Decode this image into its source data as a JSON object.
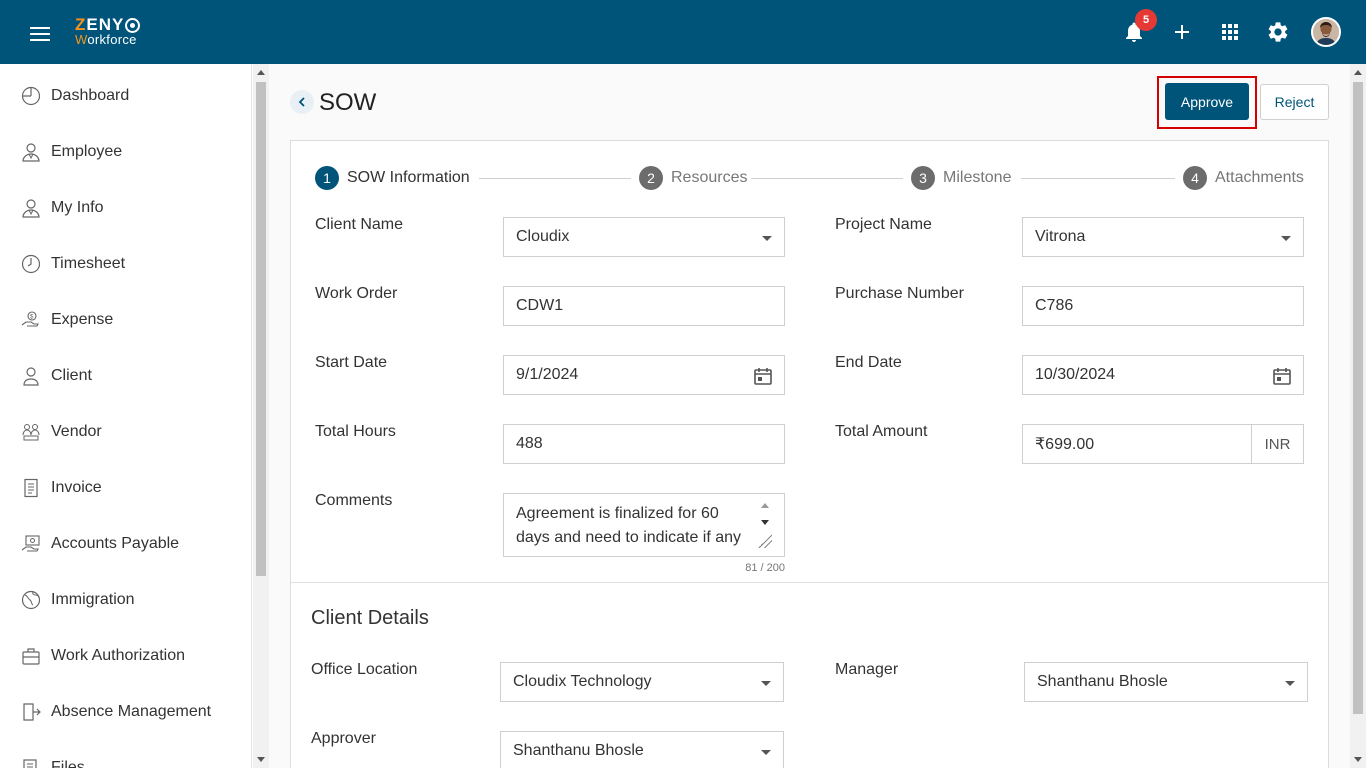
{
  "app": {
    "logo_line1_z": "Z",
    "logo_line1_rest": "ENY",
    "logo_line2_w": "W",
    "logo_line2_rest": "orkforce",
    "notification_count": "5",
    "brand_color": "#00547a",
    "accent_color": "#f7941d"
  },
  "sidebar": {
    "items": [
      {
        "label": "Dashboard",
        "icon": "dashboard-icon"
      },
      {
        "label": "Employee",
        "icon": "employee-icon"
      },
      {
        "label": "My Info",
        "icon": "my-info-icon"
      },
      {
        "label": "Timesheet",
        "icon": "clock-icon"
      },
      {
        "label": "Expense",
        "icon": "expense-icon"
      },
      {
        "label": "Client",
        "icon": "client-icon"
      },
      {
        "label": "Vendor",
        "icon": "vendor-icon"
      },
      {
        "label": "Invoice",
        "icon": "invoice-icon"
      },
      {
        "label": "Accounts Payable",
        "icon": "accounts-payable-icon"
      },
      {
        "label": "Immigration",
        "icon": "globe-icon"
      },
      {
        "label": "Work Authorization",
        "icon": "briefcase-icon"
      },
      {
        "label": "Absence Management",
        "icon": "exit-door-icon"
      },
      {
        "label": "Files",
        "icon": "files-icon"
      }
    ]
  },
  "page": {
    "title": "SOW",
    "approve_label": "Approve",
    "reject_label": "Reject"
  },
  "stepper": {
    "steps": [
      {
        "num": "1",
        "label": "SOW Information",
        "active": true
      },
      {
        "num": "2",
        "label": "Resources",
        "active": false
      },
      {
        "num": "3",
        "label": "Milestone",
        "active": false
      },
      {
        "num": "4",
        "label": "Attachments",
        "active": false
      }
    ]
  },
  "sow_form": {
    "client_name": {
      "label": "Client Name",
      "value": "Cloudix"
    },
    "project_name": {
      "label": "Project Name",
      "value": "Vitrona"
    },
    "work_order": {
      "label": "Work Order",
      "value": "CDW1"
    },
    "purchase_number": {
      "label": "Purchase Number",
      "value": "C786"
    },
    "start_date": {
      "label": "Start Date",
      "value": "9/1/2024"
    },
    "end_date": {
      "label": "End Date",
      "value": "10/30/2024"
    },
    "total_hours": {
      "label": "Total Hours",
      "value": "488"
    },
    "total_amount": {
      "label": "Total Amount",
      "value": "₹699.00",
      "currency": "INR"
    },
    "comments": {
      "label": "Comments",
      "value": "Agreement is finalized for 60 days and need to indicate if any",
      "counter": "81 / 200"
    }
  },
  "client_details": {
    "title": "Client Details",
    "office_location": {
      "label": "Office Location",
      "value": "Cloudix Technology"
    },
    "manager": {
      "label": "Manager",
      "value": "Shanthanu Bhosle"
    },
    "approver": {
      "label": "Approver",
      "value": "Shanthanu Bhosle"
    }
  }
}
